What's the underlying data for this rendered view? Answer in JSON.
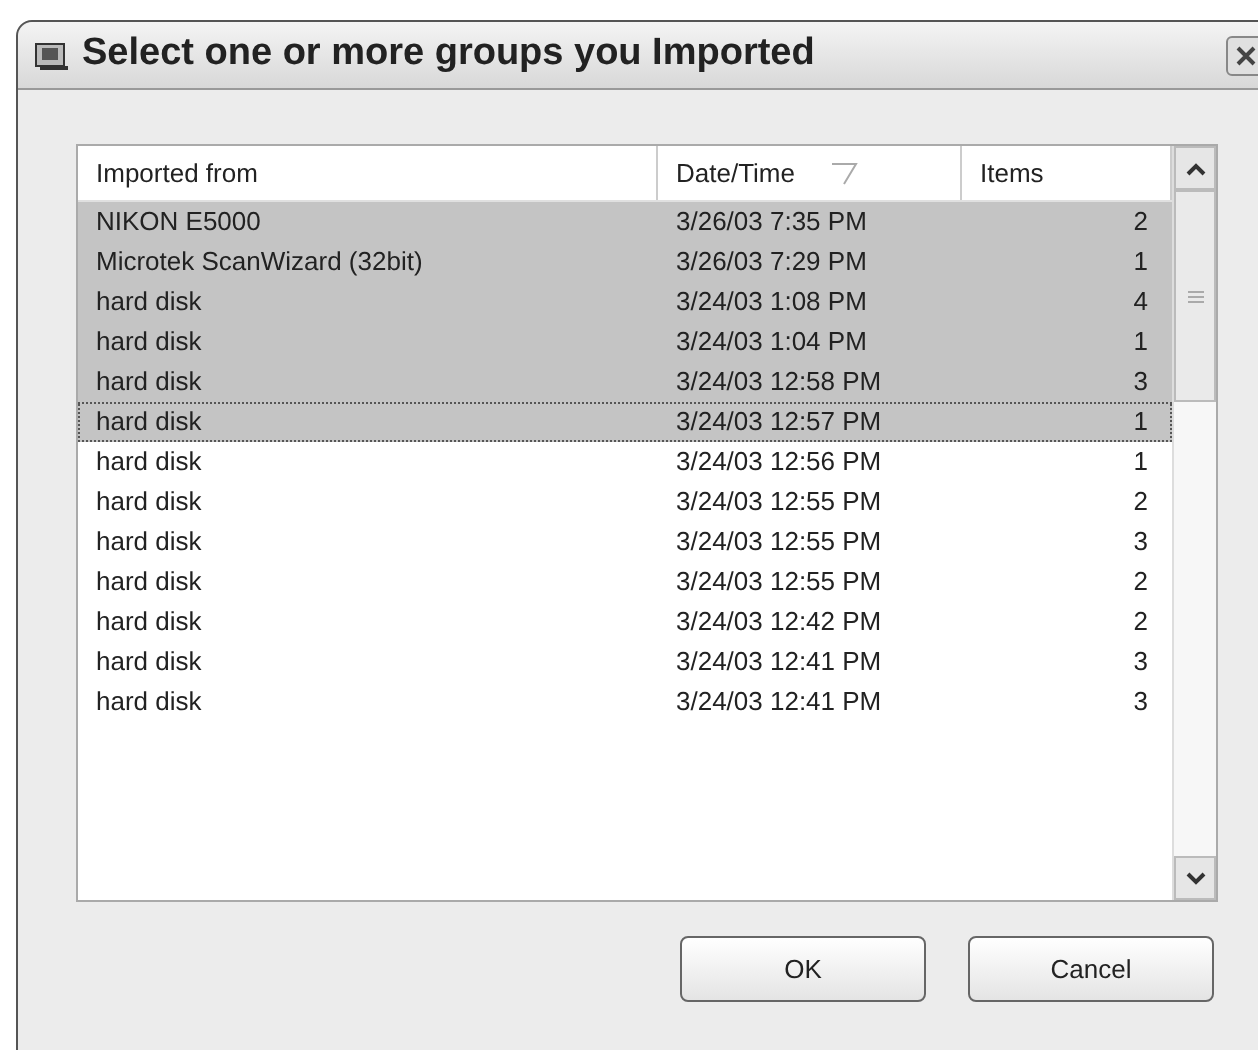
{
  "window": {
    "title": "Select one or more groups you Imported"
  },
  "table": {
    "columns": [
      {
        "label": "Imported from",
        "sorted": false
      },
      {
        "label": "Date/Time",
        "sorted": true
      },
      {
        "label": "Items",
        "sorted": false
      }
    ],
    "rows": [
      {
        "source": "NIKON E5000",
        "date": "3/26/03 7:35 PM",
        "items": "2",
        "selected": true,
        "focused": false
      },
      {
        "source": "Microtek ScanWizard (32bit)",
        "date": "3/26/03 7:29 PM",
        "items": "1",
        "selected": true,
        "focused": false
      },
      {
        "source": "hard disk",
        "date": "3/24/03 1:08 PM",
        "items": "4",
        "selected": true,
        "focused": false
      },
      {
        "source": "hard disk",
        "date": "3/24/03 1:04 PM",
        "items": "1",
        "selected": true,
        "focused": false
      },
      {
        "source": "hard disk",
        "date": "3/24/03 12:58 PM",
        "items": "3",
        "selected": true,
        "focused": false
      },
      {
        "source": "hard disk",
        "date": "3/24/03 12:57 PM",
        "items": "1",
        "selected": true,
        "focused": true
      },
      {
        "source": "hard disk",
        "date": "3/24/03 12:56 PM",
        "items": "1",
        "selected": false,
        "focused": false
      },
      {
        "source": "hard disk",
        "date": "3/24/03 12:55 PM",
        "items": "2",
        "selected": false,
        "focused": false
      },
      {
        "source": "hard disk",
        "date": "3/24/03 12:55 PM",
        "items": "3",
        "selected": false,
        "focused": false
      },
      {
        "source": "hard disk",
        "date": "3/24/03 12:55 PM",
        "items": "2",
        "selected": false,
        "focused": false
      },
      {
        "source": "hard disk",
        "date": "3/24/03 12:42 PM",
        "items": "2",
        "selected": false,
        "focused": false
      },
      {
        "source": "hard disk",
        "date": "3/24/03 12:41 PM",
        "items": "3",
        "selected": false,
        "focused": false
      },
      {
        "source": "hard disk",
        "date": "3/24/03 12:41 PM",
        "items": "3",
        "selected": false,
        "focused": false
      }
    ]
  },
  "buttons": [
    "OK",
    "Cancel"
  ]
}
